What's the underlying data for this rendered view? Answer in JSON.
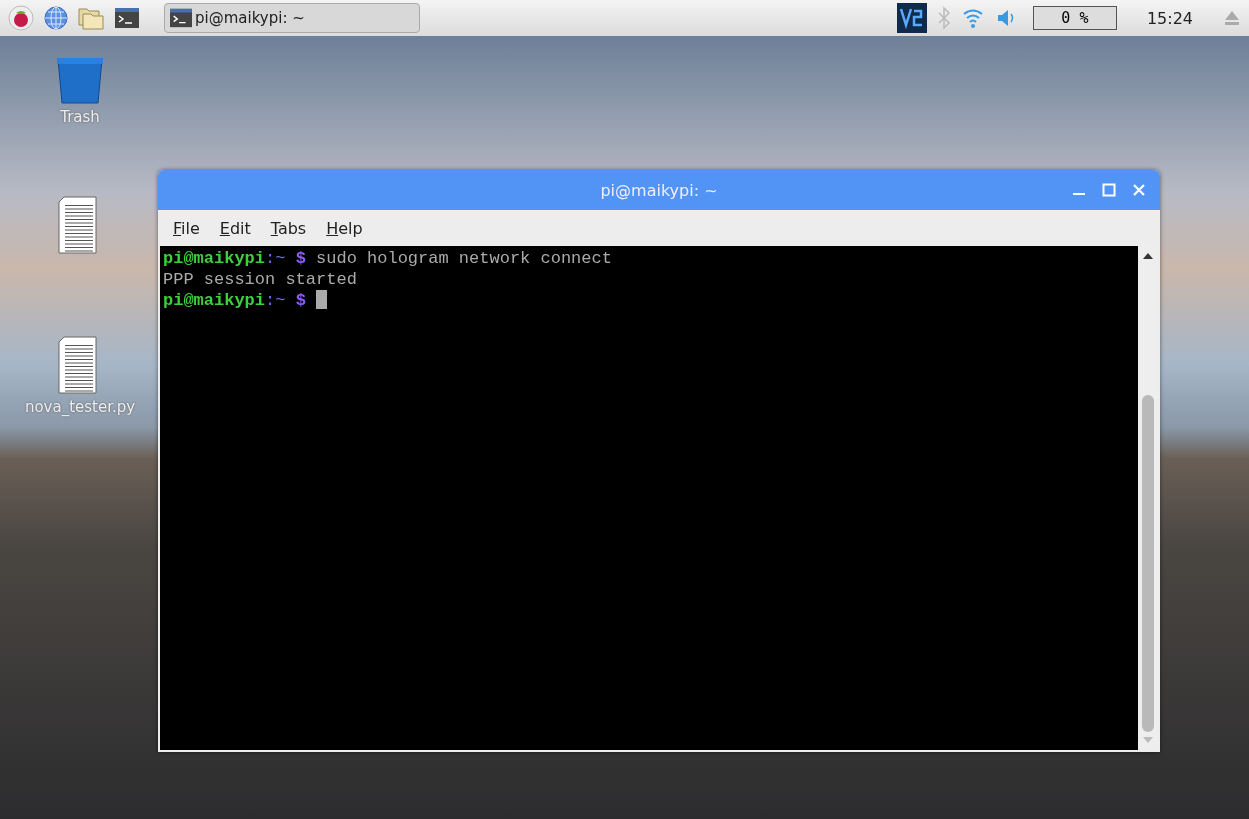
{
  "taskbar": {
    "launchers": [
      {
        "kind": "menu"
      },
      {
        "kind": "browser"
      },
      {
        "kind": "files"
      },
      {
        "kind": "terminal"
      }
    ],
    "window_button": {
      "label": "pi@maikypi: ~",
      "selected": false
    },
    "tray": {
      "cpu": "0 %",
      "clock": "15:24"
    }
  },
  "desktop_icons": [
    {
      "kind": "trash",
      "label": "Trash"
    },
    {
      "kind": "file"
    },
    {
      "kind": "file",
      "label": "nova_tester.py"
    }
  ],
  "terminal": {
    "title": "pi@maikypi: ~",
    "menu": [
      "File",
      "Edit",
      "Tabs",
      "Help"
    ],
    "lines": [
      [
        {
          "kind": "user",
          "text": "pi@maikypi"
        },
        {
          "kind": "path",
          "text": ":~"
        },
        {
          "kind": "prompt",
          "text": " $"
        },
        {
          "kind": "text",
          "text": " sudo hologram network connect"
        }
      ],
      [
        {
          "kind": "text",
          "text": "PPP session started"
        }
      ],
      [
        {
          "kind": "user",
          "text": "pi@maikypi"
        },
        {
          "kind": "path",
          "text": ":~"
        },
        {
          "kind": "prompt",
          "text": " $"
        },
        {
          "kind": "cursor"
        }
      ]
    ]
  }
}
